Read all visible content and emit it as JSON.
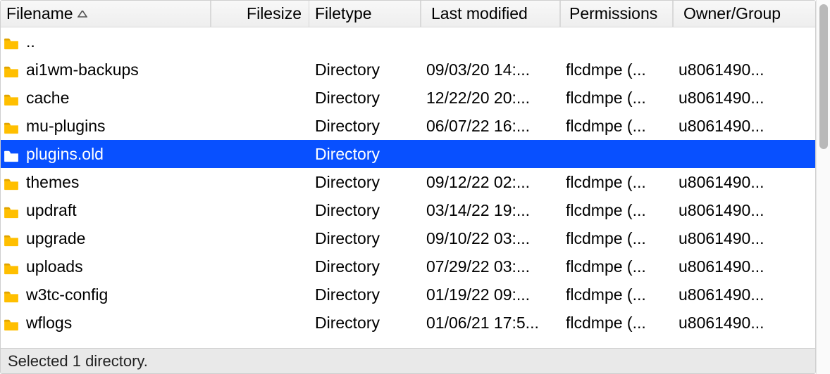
{
  "columns": {
    "filename": "Filename",
    "filesize": "Filesize",
    "filetype": "Filetype",
    "modified": "Last modified",
    "permissions": "Permissions",
    "owner": "Owner/Group"
  },
  "sort": {
    "column": "filename",
    "direction": "asc"
  },
  "rows": [
    {
      "filename": "..",
      "filesize": "",
      "filetype": "",
      "modified": "",
      "permissions": "",
      "owner": "",
      "parent": true
    },
    {
      "filename": "ai1wm-backups",
      "filesize": "",
      "filetype": "Directory",
      "modified": "09/03/20 14:...",
      "permissions": "flcdmpe (...",
      "owner": "u8061490..."
    },
    {
      "filename": "cache",
      "filesize": "",
      "filetype": "Directory",
      "modified": "12/22/20 20:...",
      "permissions": "flcdmpe (...",
      "owner": "u8061490..."
    },
    {
      "filename": "mu-plugins",
      "filesize": "",
      "filetype": "Directory",
      "modified": "06/07/22 16:...",
      "permissions": "flcdmpe (...",
      "owner": "u8061490..."
    },
    {
      "filename": "plugins.old",
      "filesize": "",
      "filetype": "Directory",
      "modified": "",
      "permissions": "",
      "owner": "",
      "selected": true
    },
    {
      "filename": "themes",
      "filesize": "",
      "filetype": "Directory",
      "modified": "09/12/22 02:...",
      "permissions": "flcdmpe (...",
      "owner": "u8061490..."
    },
    {
      "filename": "updraft",
      "filesize": "",
      "filetype": "Directory",
      "modified": "03/14/22 19:...",
      "permissions": "flcdmpe (...",
      "owner": "u8061490..."
    },
    {
      "filename": "upgrade",
      "filesize": "",
      "filetype": "Directory",
      "modified": "09/10/22 03:...",
      "permissions": "flcdmpe (...",
      "owner": "u8061490..."
    },
    {
      "filename": "uploads",
      "filesize": "",
      "filetype": "Directory",
      "modified": "07/29/22 03:...",
      "permissions": "flcdmpe (...",
      "owner": "u8061490..."
    },
    {
      "filename": "w3tc-config",
      "filesize": "",
      "filetype": "Directory",
      "modified": "01/19/22 09:...",
      "permissions": "flcdmpe (...",
      "owner": "u8061490..."
    },
    {
      "filename": "wflogs",
      "filesize": "",
      "filetype": "Directory",
      "modified": "01/06/21 17:5...",
      "permissions": "flcdmpe (...",
      "owner": "u8061490..."
    }
  ],
  "status": "Selected 1 directory.",
  "colors": {
    "selection": "#0850ff",
    "folder": "#ffbf00"
  }
}
